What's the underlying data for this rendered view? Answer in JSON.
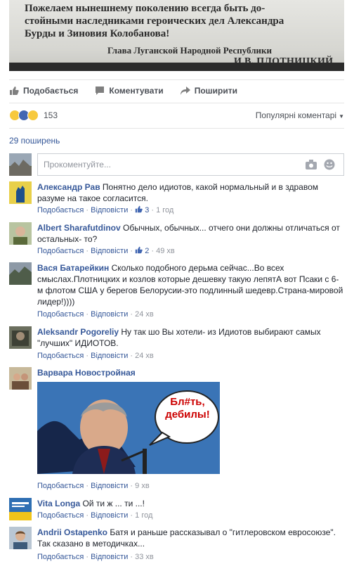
{
  "post_image": {
    "lines": [
      "Пожелаем нынешнему поколению всегда быть до-",
      "стойными наследниками героических дел Александра",
      "Бурды и Зиновия Колобанова!",
      "Глава Луганской Народной Республики",
      "И.В. ПЛОТНИЦКИЙ"
    ]
  },
  "actions": {
    "like": "Подобається",
    "comment": "Коментувати",
    "share": "Поширити"
  },
  "reactions": {
    "count": "153",
    "sort": "Популярні коментарі"
  },
  "shares": "29 поширень",
  "composer": {
    "placeholder": "Прокоментуйте..."
  },
  "meta_labels": {
    "like": "Подобається",
    "reply": "Відповісти",
    "sep": "·"
  },
  "comments": [
    {
      "author": "Александр Рав",
      "text": "Понятно дело идиотов, какой нормальный и в здравом разуме на такое согласится.",
      "likes": "3",
      "time": "1 год"
    },
    {
      "author": "Albert Sharafutdinov",
      "text": "Обычных, обычных... отчего они должны отличаться от остальных- то?",
      "likes": "2",
      "time": "49 хв"
    },
    {
      "author": "Вася Батарейкин",
      "text": "Сколько подобного дерьма сейчас...Во всех смыслах.Плотницких и козлов которые дешевку такую лепятА вот Псаки с 6-м флотом США у берегов Белорусии-это подлинный шедевр.Страна-мировой лидер!))))",
      "likes": "",
      "time": "24 хв"
    },
    {
      "author": "Aleksandr Pogoreliy",
      "text": "Ну так шо Вы хотели- из Идиотов выбирают самых \"лучших\" ИДИОТОВ.",
      "likes": "",
      "time": "24 хв"
    },
    {
      "author": "Варвара Новостройная",
      "text": "",
      "likes": "",
      "time": "9 хв",
      "image_text": "Бл#ть, дебилы!"
    },
    {
      "author": "Vita Longa",
      "text": "Ой ти ж ... ти ...!",
      "likes": "",
      "time": "1 год"
    },
    {
      "author": "Andrii Ostapenko",
      "text": "Батя и раньше рассказывал о \"гитлеровском евросоюзе\". Так сказано в методичках...",
      "likes": "",
      "time": "33 хв"
    }
  ],
  "colors": {
    "link": "#365899",
    "text": "#1d2129",
    "muted": "#90949c",
    "accent_red": "#d40000"
  },
  "icons": [
    "thumbs-up-icon",
    "comment-icon",
    "share-arrow-icon",
    "haha-reaction-icon",
    "like-reaction-icon",
    "wow-reaction-icon",
    "camera-icon",
    "smiley-icon",
    "caret-down-icon"
  ]
}
